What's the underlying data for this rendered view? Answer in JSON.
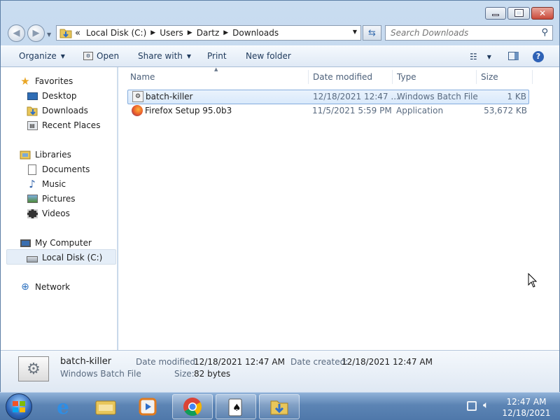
{
  "address": {
    "chevron": "«",
    "crumbs": [
      "Local Disk (C:)",
      "Users",
      "Dartz",
      "Downloads"
    ]
  },
  "search": {
    "placeholder": "Search Downloads"
  },
  "toolbar": {
    "organize": "Organize",
    "open": "Open",
    "share_with": "Share with",
    "print": "Print",
    "new_folder": "New folder"
  },
  "nav": {
    "favorites": {
      "label": "Favorites",
      "items": [
        "Desktop",
        "Downloads",
        "Recent Places"
      ]
    },
    "libraries": {
      "label": "Libraries",
      "items": [
        "Documents",
        "Music",
        "Pictures",
        "Videos"
      ]
    },
    "computer": {
      "label": "My Computer",
      "items": [
        "Local Disk (C:)"
      ]
    },
    "network": "Network"
  },
  "columns": {
    "name": "Name",
    "date": "Date modified",
    "type": "Type",
    "size": "Size"
  },
  "files": [
    {
      "name": "batch-killer",
      "date": "12/18/2021 12:47 ...",
      "type": "Windows Batch File",
      "size": "1 KB"
    },
    {
      "name": "Firefox Setup 95.0b3",
      "date": "11/5/2021 5:59 PM",
      "type": "Application",
      "size": "53,672 KB"
    }
  ],
  "details": {
    "name": "batch-killer",
    "type": "Windows Batch File",
    "modified_label": "Date modified:",
    "modified": "12/18/2021 12:47 AM",
    "created_label": "Date created:",
    "created": "12/18/2021 12:47 AM",
    "size_label": "Size:",
    "size": "82 bytes"
  },
  "clock": {
    "time": "12:47 AM",
    "date": "12/18/2021"
  },
  "icons": [
    "back-icon",
    "forward-icon",
    "folder-icon",
    "refresh-icon",
    "search-icon",
    "view-icon",
    "preview-pane-icon",
    "help-icon",
    "star-icon",
    "desktop-icon",
    "downloads-icon",
    "recent-icon",
    "library-icon",
    "documents-icon",
    "music-icon",
    "pictures-icon",
    "videos-icon",
    "computer-icon",
    "drive-icon",
    "network-icon",
    "batch-file-icon",
    "firefox-icon",
    "start-icon",
    "ie-icon",
    "explorer-icon",
    "media-player-icon",
    "chrome-icon",
    "solitaire-icon",
    "downloads-folder-icon",
    "network-tray-icon",
    "volume-icon"
  ]
}
